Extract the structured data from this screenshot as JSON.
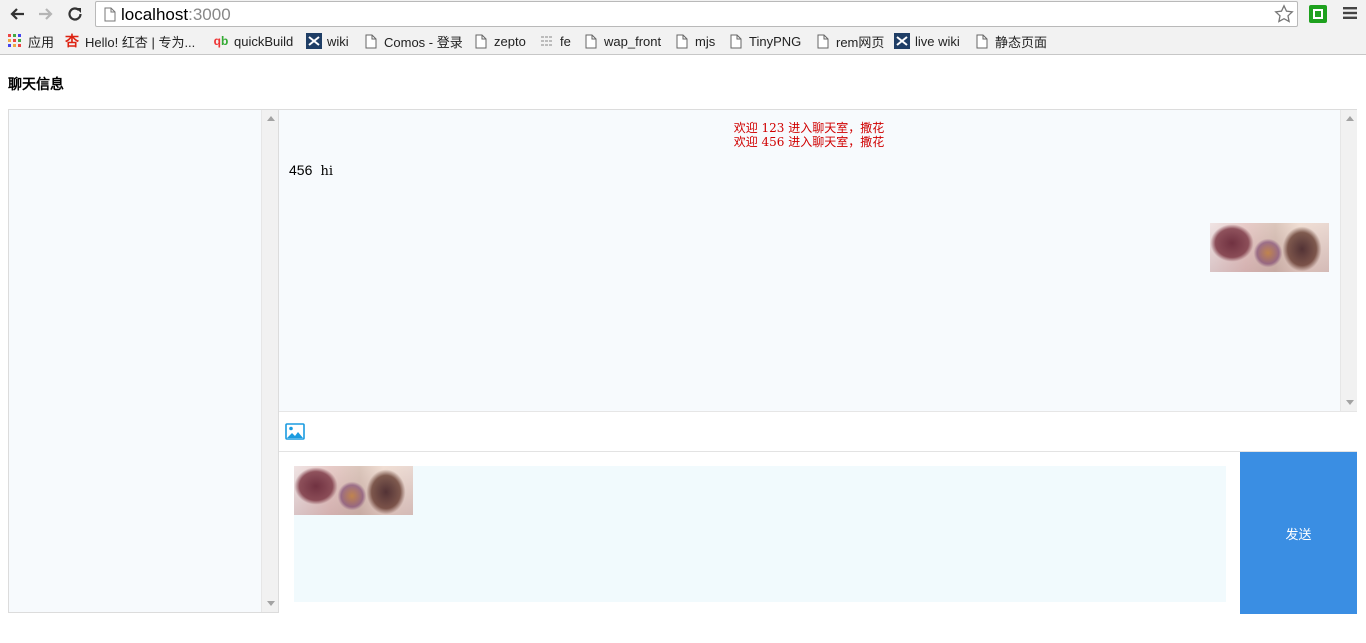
{
  "browser": {
    "url_host": "localhost",
    "url_port": ":3000",
    "bookmarks": [
      {
        "label": "应用",
        "icon": "apps-grid-icon"
      },
      {
        "label": "Hello! 红杏 | 专为...",
        "icon": "apricot-icon"
      },
      {
        "label": "quickBuild",
        "icon": "qb-icon"
      },
      {
        "label": "wiki",
        "icon": "confluence-icon"
      },
      {
        "label": "Comos - 登录",
        "icon": "page-icon"
      },
      {
        "label": "zepto",
        "icon": "page-icon"
      },
      {
        "label": "fe",
        "icon": "lines-icon"
      },
      {
        "label": "wap_front",
        "icon": "page-icon"
      },
      {
        "label": "mjs",
        "icon": "page-icon"
      },
      {
        "label": "TinyPNG",
        "icon": "page-icon"
      },
      {
        "label": "rem网页",
        "icon": "page-icon"
      },
      {
        "label": "live wiki",
        "icon": "confluence-icon"
      },
      {
        "label": "静态页面",
        "icon": "page-icon"
      }
    ]
  },
  "page": {
    "title": "聊天信息"
  },
  "chat": {
    "system_messages": [
      "欢迎 123 进入聊天室，撒花",
      "欢迎 456 进入聊天室，撒花"
    ],
    "messages": [
      {
        "from": "456",
        "text": "hi"
      }
    ],
    "send_label": "发送"
  },
  "colors": {
    "system_text": "#d00000",
    "send_button": "#3a8ee3",
    "panel_bg": "#f7fafd",
    "editor_bg": "#f1fafd"
  }
}
